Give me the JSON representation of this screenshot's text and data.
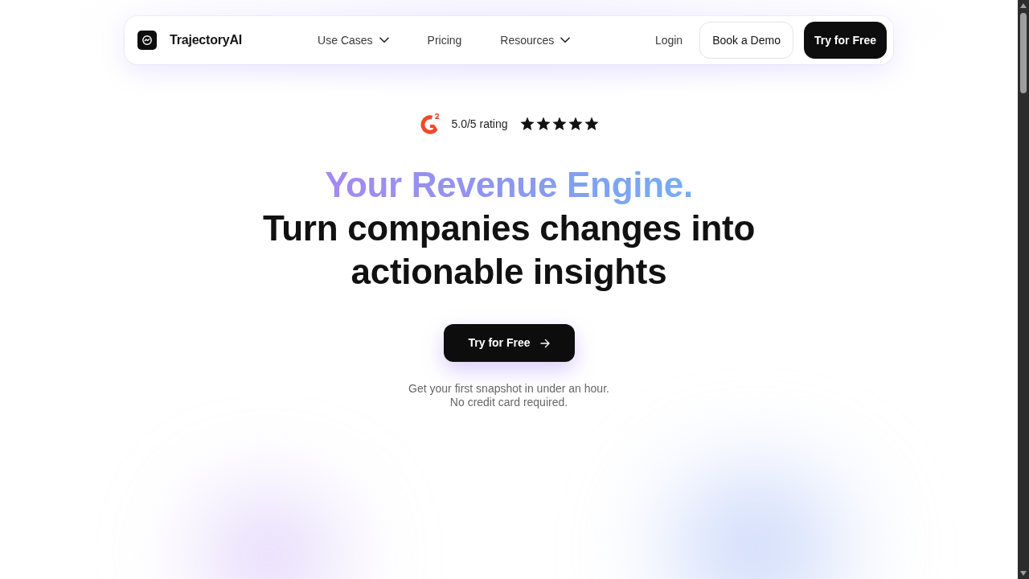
{
  "nav": {
    "brand": "TrajectoryAI",
    "links": [
      {
        "label": "Use Cases",
        "dropdown": true
      },
      {
        "label": "Pricing",
        "dropdown": false
      },
      {
        "label": "Resources",
        "dropdown": true
      }
    ],
    "login": "Login",
    "buttons": [
      {
        "label": "Book a Demo",
        "kind": "outline"
      },
      {
        "label": "Try for Free",
        "kind": "solid"
      }
    ]
  },
  "rating": {
    "text": "5.0/5 rating",
    "stars": 5
  },
  "hero": {
    "highlight": "Your Revenue Engine.",
    "headline": "Turn companies changes into actionable insights",
    "cta": "Try for Free",
    "note_lines": [
      "Get your first snapshot in under an hour.",
      "No credit card required."
    ]
  }
}
